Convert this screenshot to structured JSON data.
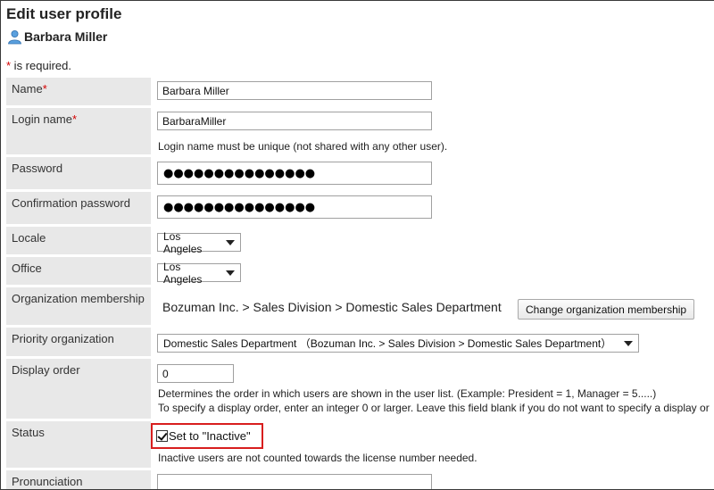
{
  "page": {
    "title": "Edit user profile"
  },
  "user": {
    "name": "Barbara Miller",
    "icon": "user-icon"
  },
  "required_note": {
    "star": "*",
    "text": " is required."
  },
  "fields": {
    "name": {
      "label": "Name",
      "required": "*",
      "value": "Barbara Miller"
    },
    "login_name": {
      "label": "Login name",
      "required": "*",
      "value": "BarbaraMiller",
      "hint": "Login name must be unique (not shared with any other user)."
    },
    "password": {
      "label": "Password",
      "value": "●●●●●●●●●●●●●●●"
    },
    "confirm_password": {
      "label": "Confirmation password",
      "value": "●●●●●●●●●●●●●●●"
    },
    "locale": {
      "label": "Locale",
      "value": "Los Angeles"
    },
    "office": {
      "label": "Office",
      "value": "Los Angeles"
    },
    "organization_membership": {
      "label": "Organization membership",
      "value": "Bozuman Inc. > Sales Division > Domestic Sales Department",
      "button": "Change organization membership"
    },
    "priority_organization": {
      "label": "Priority organization",
      "value": "Domestic Sales Department （Bozuman Inc. > Sales Division > Domestic Sales Department）"
    },
    "display_order": {
      "label": "Display order",
      "value": "0",
      "hint1": "Determines the order in which users are shown in the user list. (Example: President = 1, Manager = 5.....)",
      "hint2": "To specify a display order, enter an integer 0 or larger. Leave this field blank if you do not want to specify a display or"
    },
    "status": {
      "label": "Status",
      "checkbox_label": "Set to \"Inactive\"",
      "checked": true,
      "hint": "Inactive users are not counted towards the license number needed."
    },
    "pronunciation": {
      "label": "Pronunciation",
      "value": ""
    }
  },
  "colors": {
    "label_bg": "#e8e8e8",
    "required": "#d30000",
    "highlight": "#d81e1e"
  }
}
